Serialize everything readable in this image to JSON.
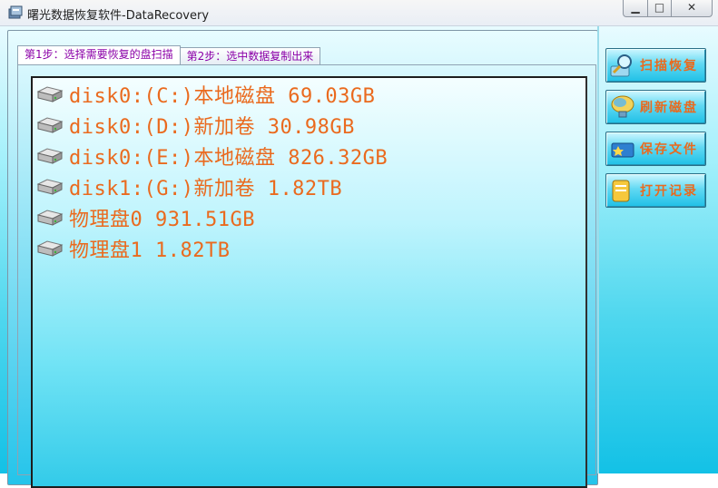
{
  "window": {
    "title": "曙光数据恢复软件-DataRecovery",
    "controls": {
      "minimize": "▁",
      "maximize": "□",
      "close": "✕"
    }
  },
  "tabs": [
    {
      "label": "第1步：选择需要恢复的盘扫描",
      "active": true
    },
    {
      "label": "第2步：选中数据复制出来",
      "active": false
    }
  ],
  "disks": [
    {
      "label": "disk0:(C:)本地磁盘 69.03GB",
      "icon": "hard-drive-icon"
    },
    {
      "label": "disk0:(D:)新加卷 30.98GB",
      "icon": "hard-drive-icon"
    },
    {
      "label": "disk0:(E:)本地磁盘 826.32GB",
      "icon": "hard-drive-icon"
    },
    {
      "label": "disk1:(G:)新加卷 1.82TB",
      "icon": "hard-drive-icon"
    },
    {
      "label": "物理盘0 931.51GB",
      "icon": "hard-drive-icon"
    },
    {
      "label": "物理盘1 1.82TB",
      "icon": "hard-drive-icon"
    }
  ],
  "buttons": {
    "scan": {
      "label": "扫描恢复",
      "icon": "magnifier-icon"
    },
    "refresh": {
      "label": "刷新磁盘",
      "icon": "globe-refresh-icon"
    },
    "save": {
      "label": "保存文件",
      "icon": "save-folder-icon"
    },
    "open": {
      "label": "打开记录",
      "icon": "open-folder-icon"
    }
  },
  "colors": {
    "accent_text": "#ea6a1e",
    "tab_text": "#8b00a8",
    "background": "#13c1e6"
  }
}
